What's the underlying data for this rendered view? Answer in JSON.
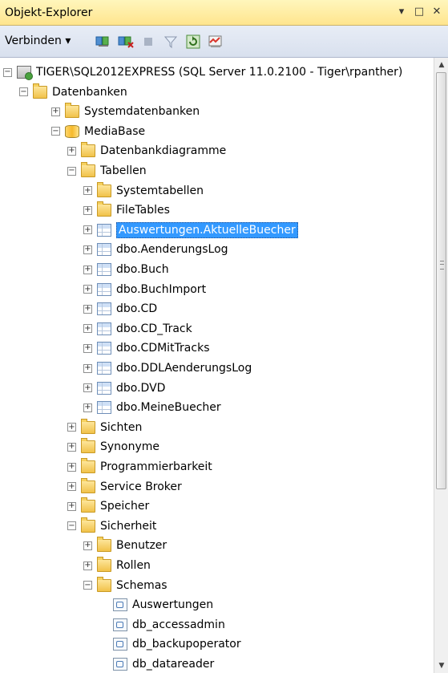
{
  "window": {
    "title": "Objekt-Explorer",
    "title_buttons": [
      "▾",
      "□",
      "✕"
    ]
  },
  "toolbar": {
    "connect_label": "Verbinden",
    "connect_arrow": "▾"
  },
  "tree": {
    "items": [
      {
        "label": "TIGER\\SQL2012EXPRESS (SQL Server 11.0.2100 - Tiger\\rpanther)",
        "exp": "−",
        "icon": "server-icon"
      },
      {
        "label": "Datenbanken",
        "exp": "−",
        "icon": "folder-icon"
      },
      {
        "label": "Systemdatenbanken",
        "exp": "+",
        "icon": "folder-icon"
      },
      {
        "label": "MediaBase",
        "exp": "−",
        "icon": "database-icon"
      },
      {
        "label": "Datenbankdiagramme",
        "exp": "+",
        "icon": "folder-icon"
      },
      {
        "label": "Tabellen",
        "exp": "−",
        "icon": "folder-icon"
      },
      {
        "label": "Systemtabellen",
        "exp": "+",
        "icon": "folder-icon"
      },
      {
        "label": "FileTables",
        "exp": "+",
        "icon": "folder-icon"
      },
      {
        "label": "Auswertungen.AktuelleBuecher",
        "exp": "+",
        "icon": "table-icon",
        "selected": true
      },
      {
        "label": "dbo.AenderungsLog",
        "exp": "+",
        "icon": "table-icon"
      },
      {
        "label": "dbo.Buch",
        "exp": "+",
        "icon": "table-icon"
      },
      {
        "label": "dbo.BuchImport",
        "exp": "+",
        "icon": "table-icon"
      },
      {
        "label": "dbo.CD",
        "exp": "+",
        "icon": "table-icon"
      },
      {
        "label": "dbo.CD_Track",
        "exp": "+",
        "icon": "table-icon"
      },
      {
        "label": "dbo.CDMitTracks",
        "exp": "+",
        "icon": "table-icon"
      },
      {
        "label": "dbo.DDLAenderungsLog",
        "exp": "+",
        "icon": "table-icon"
      },
      {
        "label": "dbo.DVD",
        "exp": "+",
        "icon": "table-icon"
      },
      {
        "label": "dbo.MeineBuecher",
        "exp": "+",
        "icon": "table-icon"
      },
      {
        "label": "Sichten",
        "exp": "+",
        "icon": "folder-icon"
      },
      {
        "label": "Synonyme",
        "exp": "+",
        "icon": "folder-icon"
      },
      {
        "label": "Programmierbarkeit",
        "exp": "+",
        "icon": "folder-icon"
      },
      {
        "label": "Service Broker",
        "exp": "+",
        "icon": "folder-icon"
      },
      {
        "label": "Speicher",
        "exp": "+",
        "icon": "folder-icon"
      },
      {
        "label": "Sicherheit",
        "exp": "−",
        "icon": "folder-icon"
      },
      {
        "label": "Benutzer",
        "exp": "+",
        "icon": "folder-icon"
      },
      {
        "label": "Rollen",
        "exp": "+",
        "icon": "folder-icon"
      },
      {
        "label": "Schemas",
        "exp": "−",
        "icon": "folder-icon"
      },
      {
        "label": "Auswertungen",
        "exp": "",
        "icon": "schema-icon"
      },
      {
        "label": "db_accessadmin",
        "exp": "",
        "icon": "schema-icon"
      },
      {
        "label": "db_backupoperator",
        "exp": "",
        "icon": "schema-icon"
      },
      {
        "label": "db_datareader",
        "exp": "",
        "icon": "schema-icon"
      }
    ]
  }
}
